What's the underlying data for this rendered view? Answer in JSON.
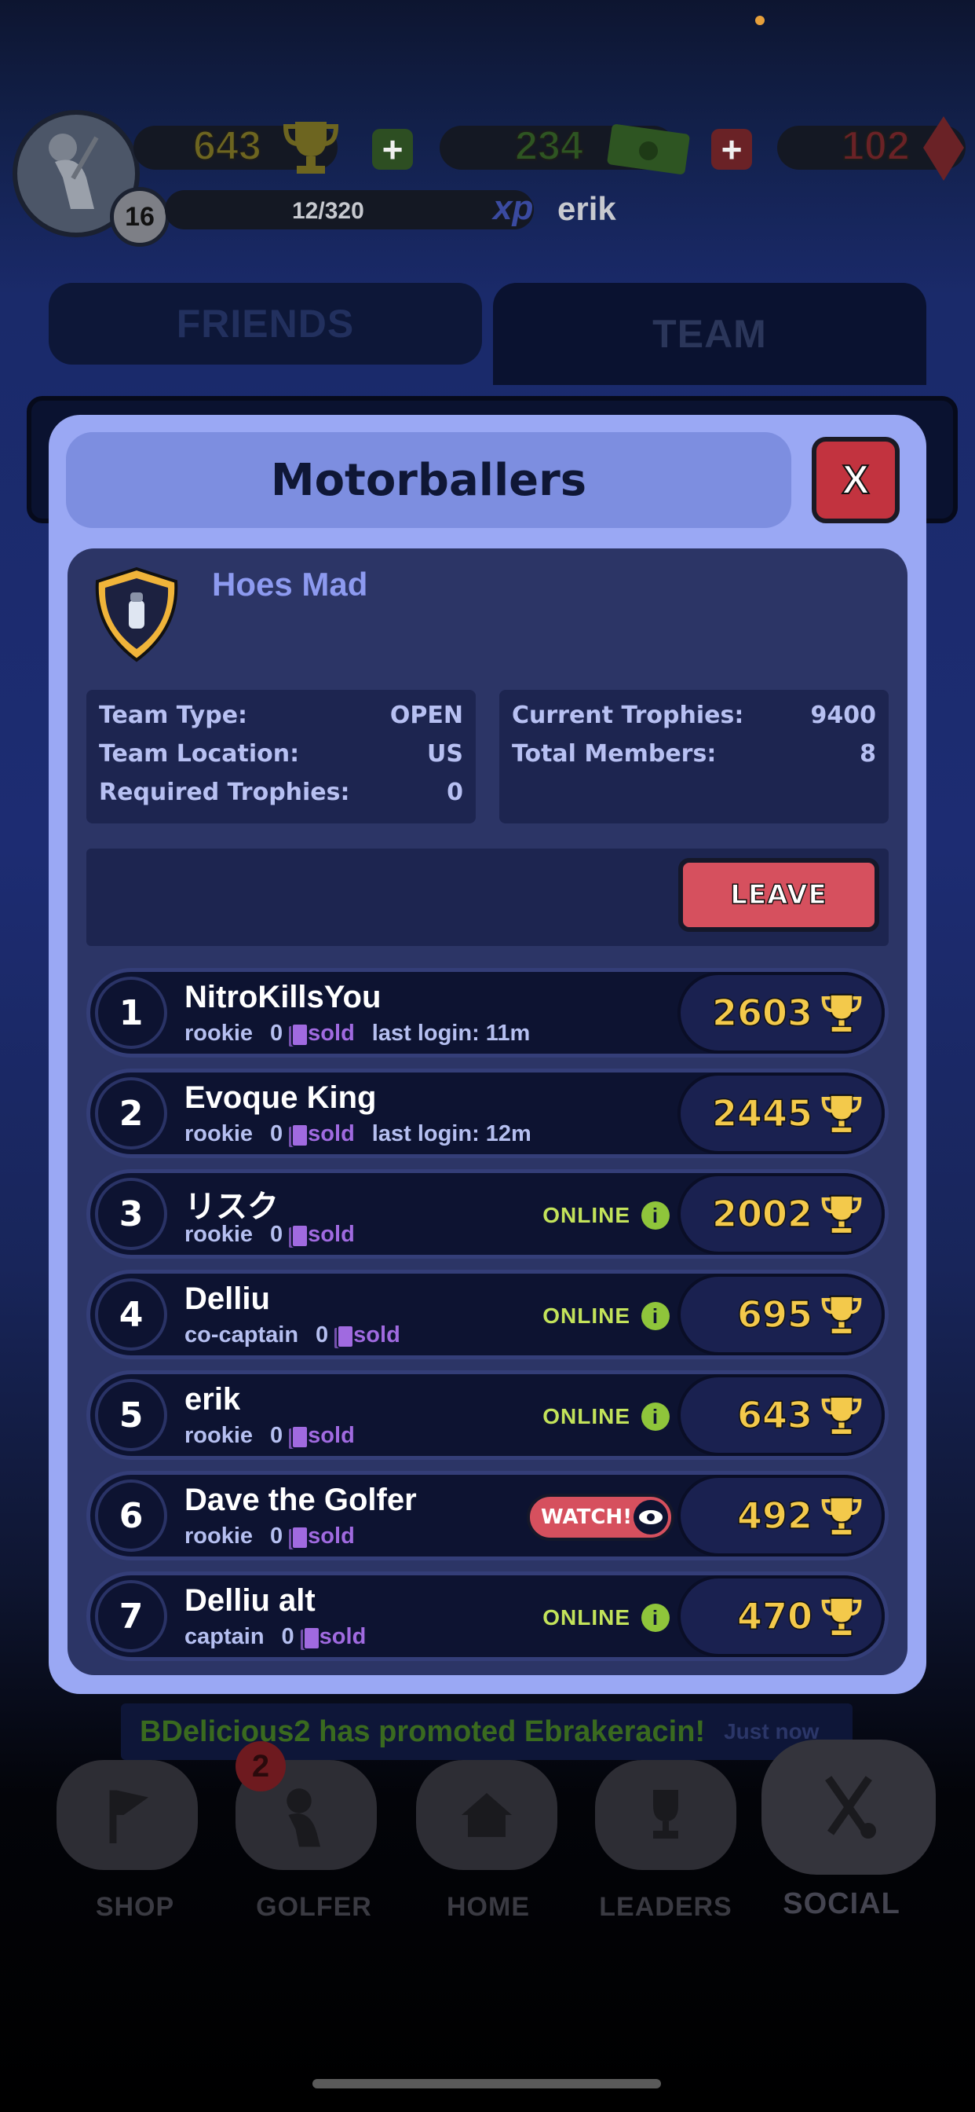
{
  "hud": {
    "level": "16",
    "trophies": "643",
    "cash": "234",
    "gems": "102",
    "xp_progress": "12/320",
    "xp_label": "xp",
    "username": "erik"
  },
  "tabs": {
    "friends": "FRIENDS",
    "team": "TEAM"
  },
  "modal": {
    "title": "Motorballers",
    "close_label": "X",
    "team_name": "Hoes Mad",
    "info_left": [
      {
        "label": "Team Type:",
        "value": "OPEN"
      },
      {
        "label": "Team Location:",
        "value": "US"
      },
      {
        "label": "Required Trophies:",
        "value": "0"
      }
    ],
    "info_right": [
      {
        "label": "Current Trophies:",
        "value": "9400"
      },
      {
        "label": "Total Members:",
        "value": "8"
      }
    ],
    "leave_label": "LEAVE",
    "sold_label": "sold",
    "online_label": "ONLINE",
    "watch_label": "WATCH!",
    "members": [
      {
        "rank": "1",
        "name": "NitroKillsYou",
        "role": "rookie",
        "cards": "0",
        "last_login": "last login: 11m",
        "trophies": "2603",
        "status": "login"
      },
      {
        "rank": "2",
        "name": "Evoque King",
        "role": "rookie",
        "cards": "0",
        "last_login": "last login: 12m",
        "trophies": "2445",
        "status": "login"
      },
      {
        "rank": "3",
        "name": "リスク",
        "role": "rookie",
        "cards": "0",
        "last_login": "",
        "trophies": "2002",
        "status": "online"
      },
      {
        "rank": "4",
        "name": "Delliu",
        "role": "co-captain",
        "cards": "0",
        "last_login": "",
        "trophies": "695",
        "status": "online"
      },
      {
        "rank": "5",
        "name": "erik",
        "role": "rookie",
        "cards": "0",
        "last_login": "",
        "trophies": "643",
        "status": "online"
      },
      {
        "rank": "6",
        "name": "Dave the Golfer",
        "role": "rookie",
        "cards": "0",
        "last_login": "",
        "trophies": "492",
        "status": "watch"
      },
      {
        "rank": "7",
        "name": "Delliu alt",
        "role": "captain",
        "cards": "0",
        "last_login": "",
        "trophies": "470",
        "status": "online"
      }
    ]
  },
  "notification": {
    "message": "BDelicious2 has promoted Ebrakeracin!",
    "time": "Just now"
  },
  "nav": {
    "items": [
      {
        "label": "SHOP",
        "icon": "flag-icon"
      },
      {
        "label": "GOLFER",
        "icon": "golfer-icon"
      },
      {
        "label": "HOME",
        "icon": "home-icon"
      },
      {
        "label": "LEADERS",
        "icon": "trophy-icon"
      },
      {
        "label": "SOCIAL",
        "icon": "crossed-clubs-icon"
      }
    ],
    "golfer_badge": "2"
  },
  "colors": {
    "accent_gold": "#f3c94b",
    "leave_red": "#d6505e",
    "online_green": "#c3e35a",
    "modal_bg": "#9aa8f4"
  }
}
